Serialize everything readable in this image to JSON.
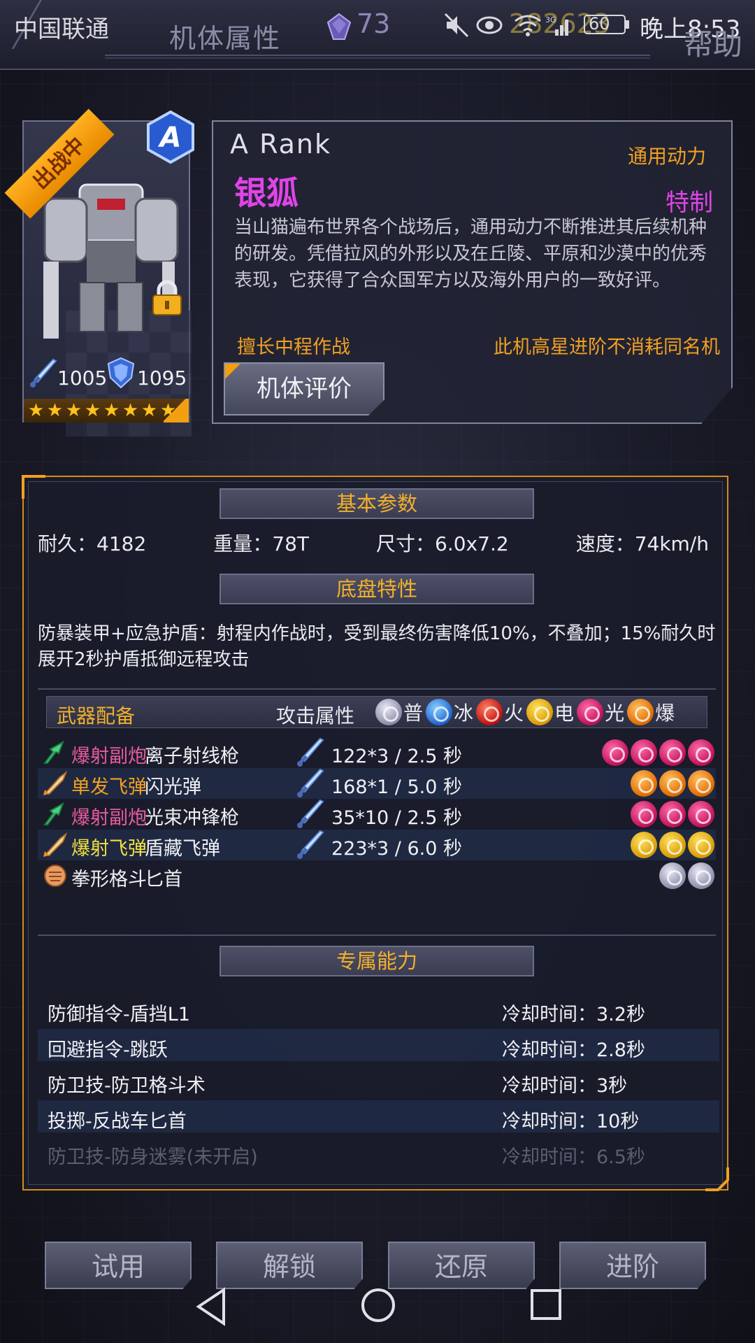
{
  "status_bar": {
    "carrier": "中国联通",
    "gem_count": "73",
    "coin_count": "282623",
    "network": "3G",
    "battery": "60",
    "time": "晚上8:53"
  },
  "header": {
    "title": "机体属性",
    "help_label": "帮助"
  },
  "mech_card": {
    "deploy_label": "出战中",
    "rank_badge": "A",
    "attack": "1005",
    "defense": "1095",
    "stars": 8
  },
  "info": {
    "rank_text": "A  Rank",
    "maker": "通用动力",
    "name": "银狐",
    "special_tag": "特制",
    "description": "当山猫遍布世界各个战场后，通用动力不断推进其后续机种的研发。凭借拉风的外形以及在丘陵、平原和沙漠中的优秀表现，它获得了合众国军方以及海外用户的一致好评。",
    "specialty": "擅长中程作战",
    "upgrade_note": "此机高星进阶不消耗同名机",
    "review_button": "机体评价"
  },
  "basic_params": {
    "title": "基本参数",
    "durability": "耐久：4182",
    "weight": "重量：78T",
    "size": "尺寸：6.0x7.2",
    "speed": "速度：74km/h"
  },
  "chassis": {
    "title": "底盘特性",
    "text": "防暴装甲+应急护盾：射程内作战时，受到最终伤害降低10%，不叠加；15%耐久时展开2秒护盾抵御远程攻击"
  },
  "weapons": {
    "title": "武器配备",
    "attr_title": "攻击属性",
    "legend": [
      {
        "label": "普",
        "element": "normal"
      },
      {
        "label": "冰",
        "element": "ice"
      },
      {
        "label": "火",
        "element": "fire"
      },
      {
        "label": "电",
        "element": "elec"
      },
      {
        "label": "光",
        "element": "light"
      },
      {
        "label": "爆",
        "element": "blast"
      }
    ],
    "rows": [
      {
        "type": "爆射副炮",
        "type_color": "#e85aa0",
        "name": "离子射线枪",
        "damage": "122*3  / 2.5 秒",
        "elements": [
          "light",
          "light",
          "light",
          "light"
        ]
      },
      {
        "type": "单发飞弹",
        "type_color": "#f2a020",
        "name": "闪光弹",
        "damage": "168*1  / 5.0 秒",
        "elements": [
          "blast",
          "blast",
          "blast"
        ]
      },
      {
        "type": "爆射副炮",
        "type_color": "#e85aa0",
        "name": "光束冲锋枪",
        "damage": "35*10  / 2.5 秒",
        "elements": [
          "light",
          "light",
          "light"
        ]
      },
      {
        "type": "爆射飞弹",
        "type_color": "#f2e040",
        "name": "盾藏飞弹",
        "damage": "223*3  / 6.0 秒",
        "elements": [
          "elec",
          "elec",
          "elec"
        ]
      },
      {
        "type": "拳形格斗",
        "type_color": "#f0f0f4",
        "name": "匕首",
        "damage": "",
        "elements": [
          "normal",
          "normal"
        ]
      }
    ]
  },
  "abilities": {
    "title": "专属能力",
    "rows": [
      {
        "name": "防御指令-盾挡L1",
        "cooldown": "冷却时间：3.2秒"
      },
      {
        "name": "回避指令-跳跃",
        "cooldown": "冷却时间：2.8秒"
      },
      {
        "name": "防卫技-防卫格斗术",
        "cooldown": "冷却时间：3秒"
      },
      {
        "name": "投掷-反战车匕首",
        "cooldown": "冷却时间：10秒"
      },
      {
        "name": "防卫技-防身迷雾(未开启)",
        "cooldown": "冷却时间：6.5秒"
      }
    ]
  },
  "buttons": {
    "trial": "试用",
    "unlock": "解锁",
    "restore": "还原",
    "advance": "进阶"
  },
  "colors": {
    "accent_orange": "#f2a020",
    "name_magenta": "#e044e8",
    "panel_border": "#d98a14"
  }
}
